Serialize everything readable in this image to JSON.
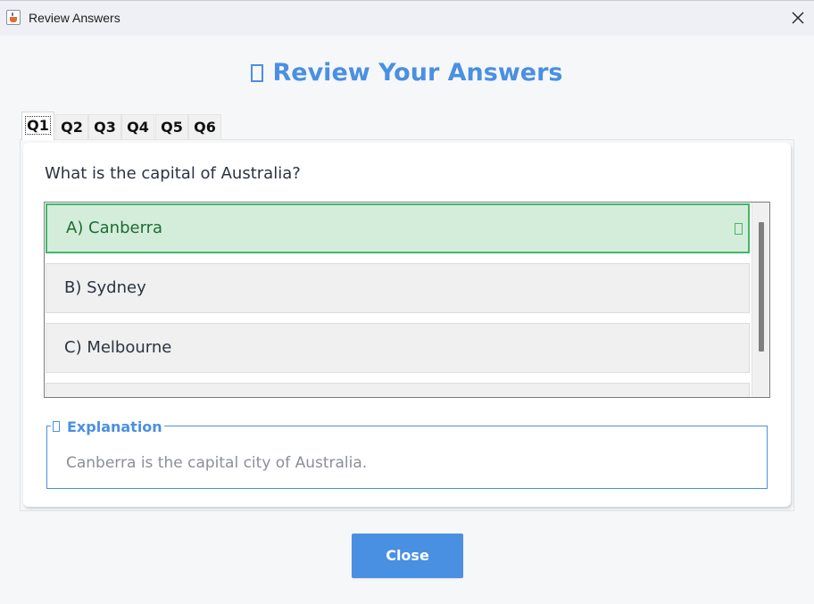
{
  "window": {
    "title": "Review Answers",
    "app_icon": "java-cup-icon",
    "close_icon": "close-icon"
  },
  "heading": {
    "text": "Review Your Answers",
    "icon": "missing-glyph-icon",
    "color": "#4a90e2"
  },
  "tabs": [
    {
      "label": "Q1",
      "active": true
    },
    {
      "label": "Q2",
      "active": false
    },
    {
      "label": "Q3",
      "active": false
    },
    {
      "label": "Q4",
      "active": false
    },
    {
      "label": "Q5",
      "active": false
    },
    {
      "label": "Q6",
      "active": false
    }
  ],
  "question": {
    "text": "What is the capital of Australia?",
    "options": [
      {
        "label": "A) Canberra",
        "state": "correct",
        "marker_icon": "check-glyph-icon"
      },
      {
        "label": "B) Sydney",
        "state": "normal"
      },
      {
        "label": "C) Melbourne",
        "state": "normal"
      }
    ],
    "colors": {
      "correct_bg": "#d4edda",
      "correct_border": "#40b868",
      "correct_text": "#1d6b33"
    }
  },
  "explanation": {
    "legend": "Explanation",
    "icon": "missing-glyph-icon",
    "text": "Canberra is the capital city of Australia."
  },
  "close_button": {
    "label": "Close",
    "color": "#4a90e2"
  }
}
